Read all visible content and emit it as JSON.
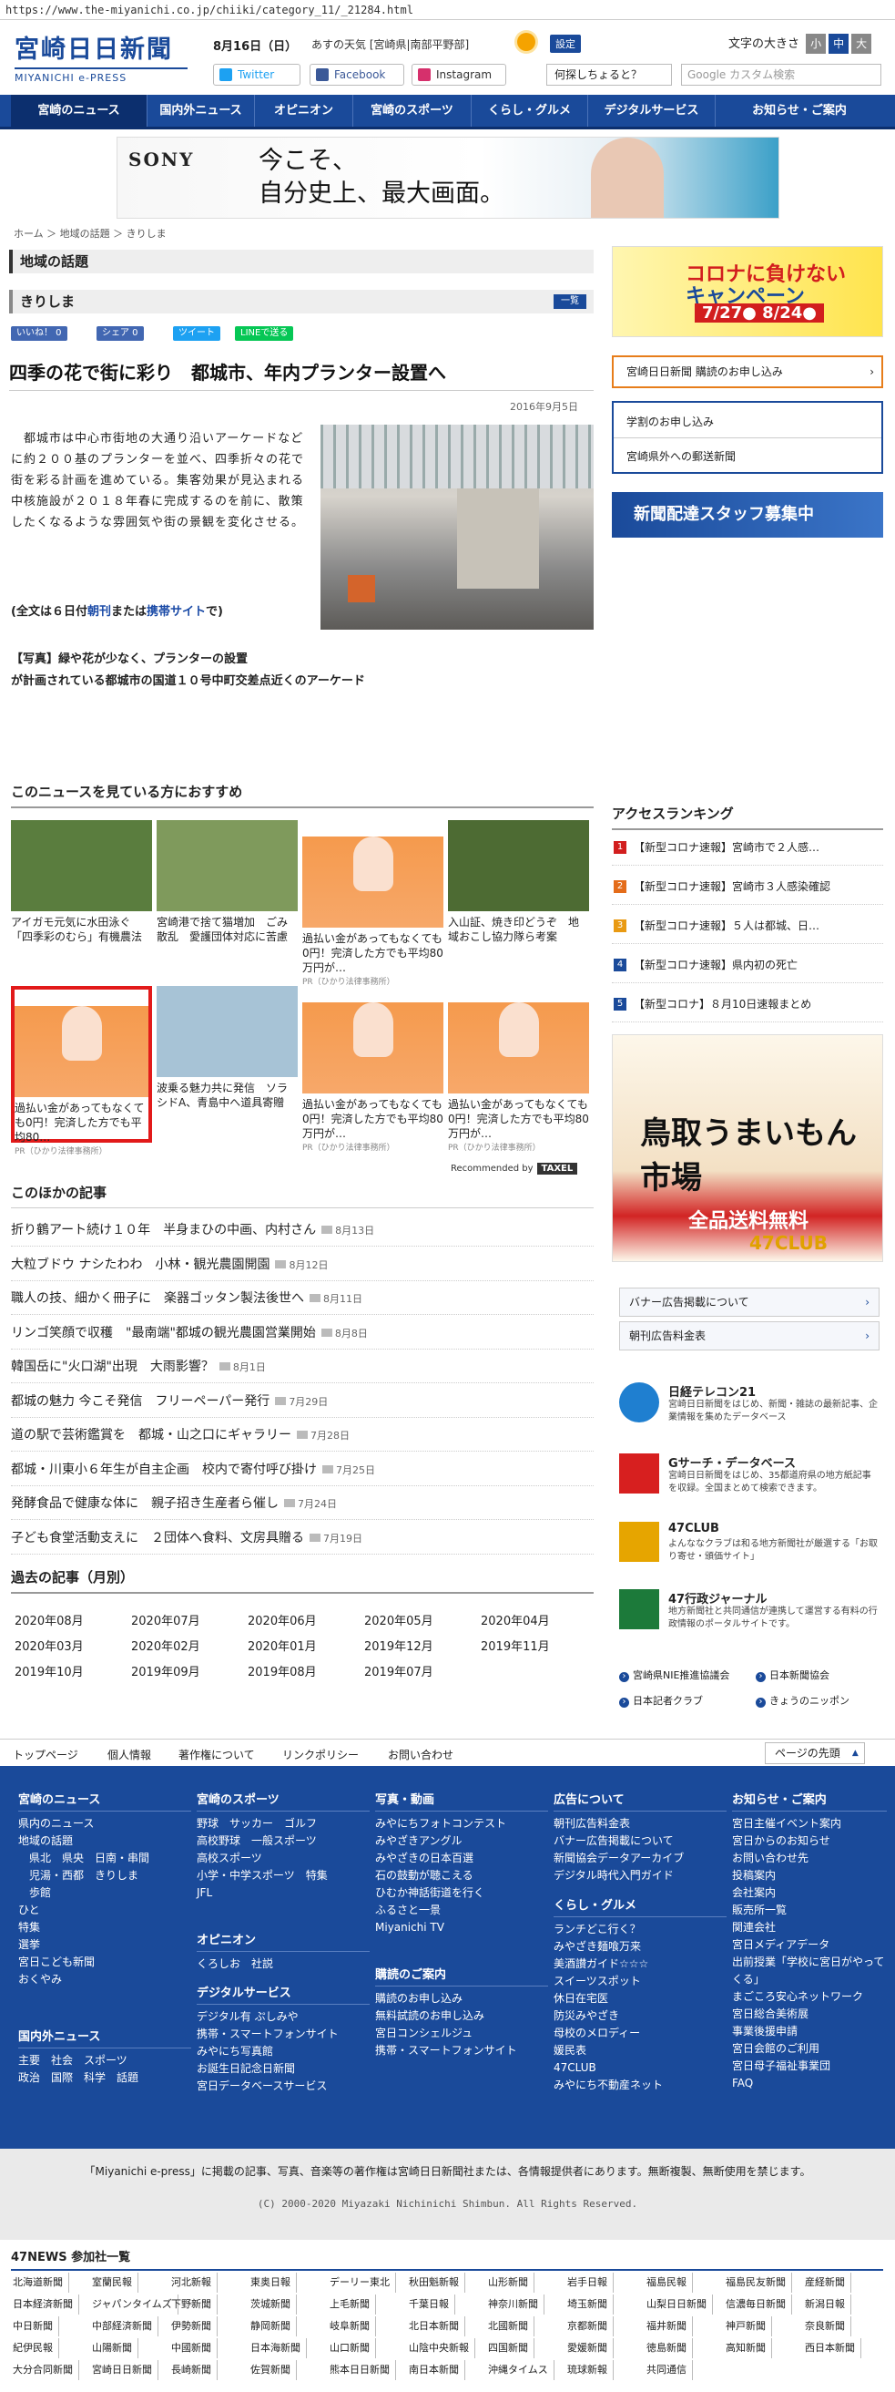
{
  "url": "https://www.the-miyanichi.co.jp/chiiki/category_11/_21284.html",
  "header": {
    "logo_top": "宮崎日日新聞",
    "logo_bottom": "MIYANICHI e-PRESS",
    "date": "8月16日（日）",
    "weather": "あすの天気 [宮崎県|南部平野部]",
    "settings": "設定",
    "font_size_label": "文字の大きさ",
    "font_small": "小",
    "font_medium": "中",
    "font_large": "大",
    "twitter": "Twitter",
    "facebook": "Facebook",
    "instagram": "Instagram",
    "ask": "何探しちょると？",
    "search_placeholder": "Google カスタム検索"
  },
  "nav": [
    "宮崎のニュース",
    "国内外ニュース",
    "オピニオン",
    "宮崎のスポーツ",
    "くらし・グルメ",
    "デジタルサービス",
    "お知らせ・ご案内"
  ],
  "ad": {
    "brand": "SONY",
    "copy1": "今こそ、",
    "copy2": "自分史上、最大画面。"
  },
  "breadcrumb": "ホーム ＞ 地域の話題 ＞ きりしま",
  "section": {
    "title": "地域の話題",
    "sub": "きりしま",
    "list_btn": "一覧"
  },
  "share": {
    "like": "いいね！ 0",
    "fb": "シェア 0",
    "tw": "ツイート",
    "line": "LINEで送る"
  },
  "article": {
    "title": "四季の花で街に彩り　都城市、年内プランター設置へ",
    "date": "2016年9月5日",
    "body": "　都城市は中心市街地の大通り沿いアーケードなどに約２００基のプランターを並べ、四季折々の花で街を彩る計画を進めている。集客効果が見込まれる中核施設が２０１８年春に完成するのを前に、散策したくなるような雰囲気や街の景観を変化させる。",
    "full_pre": "(全文は６日付",
    "full_a": "朝刊",
    "full_mid": "または",
    "full_b": "携帯サイト",
    "full_post": "で)",
    "caption1": "【写真】緑や花が少なく、プランターの設置",
    "caption2": "が計画されている都城市の国道１０号中町交差点近くのアーケード"
  },
  "recommend": {
    "title": "このニュースを見ている方におすすめ",
    "items": [
      {
        "text": "アイガモ元気に水田泳ぐ「四季彩のむら」有機農法",
        "pr": ""
      },
      {
        "text": "宮崎港で捨て猫増加　ごみ散乱　愛護団体対応に苦慮",
        "pr": ""
      },
      {
        "text": "過払い金があってもなくても0円！完済した方でも平均80万円が…",
        "pr": "PR（ひかり法律事務所）"
      },
      {
        "text": "入山証、焼き印どうぞ　地域おこし協力隊ら考案",
        "pr": ""
      },
      {
        "text": "過払い金があってもなくても0円！完済した方でも平均80…",
        "pr": "PR（ひかり法律事務所）"
      },
      {
        "text": "波乗る魅力共に発信　ソラシドA、青島中へ道具寄贈",
        "pr": ""
      },
      {
        "text": "過払い金があってもなくても0円！完済した方でも平均80万円が…",
        "pr": "PR（ひかり法律事務所）"
      },
      {
        "text": "過払い金があってもなくても0円！完済した方でも平均80万円が…",
        "pr": "PR（ひかり法律事務所）"
      }
    ],
    "by": "Recommended by",
    "by_logo": "TAXEL"
  },
  "other": {
    "title": "このほかの記事",
    "items": [
      {
        "t": "折り鶴アート続け１０年　半身まひの中画、内村さん",
        "d": "8月13日"
      },
      {
        "t": "大粒ブドウ ナシたわわ　小林・観光農園開園",
        "d": "8月12日"
      },
      {
        "t": "職人の技、細かく冊子に　楽器ゴッタン製法後世へ",
        "d": "8月11日"
      },
      {
        "t": "リンゴ笑顔で収穫　\"最南端\"都城の観光農園営業開始",
        "d": "8月8日"
      },
      {
        "t": "韓国岳に\"火口湖\"出現　大雨影響？",
        "d": "8月1日"
      },
      {
        "t": "都城の魅力 今こそ発信　フリーペーパー発行",
        "d": "7月29日"
      },
      {
        "t": "道の駅で芸術鑑賞を　都城・山之口にギャラリー",
        "d": "7月28日"
      },
      {
        "t": "都城・川東小６年生が自主企画　校内で寄付呼び掛け",
        "d": "7月25日"
      },
      {
        "t": "発酵食品で健康な体に　親子招き生産者ら催し",
        "d": "7月24日"
      },
      {
        "t": "子ども食堂活動支えに　２団体へ食料、文房具贈る",
        "d": "7月19日"
      }
    ]
  },
  "past": {
    "title": "過去の記事（月別）",
    "months": [
      "2020年08月",
      "2020年07月",
      "2020年06月",
      "2020年05月",
      "2020年04月",
      "2020年03月",
      "2020年02月",
      "2020年01月",
      "2019年12月",
      "2019年11月",
      "2019年10月",
      "2019年09月",
      "2019年08月",
      "2019年07月"
    ]
  },
  "side": {
    "corona_title": "コロナに負けない",
    "corona_camp": "キャンペーン",
    "corona_dates": "7/27● 8/24●",
    "subscribe": "宮崎日日新聞 購読のお申し込み",
    "gakuwari": "学割のお申し込み",
    "kengai": "宮崎県外への郵送新聞",
    "staff": "新聞配達スタッフ募集中",
    "ranking_title": "アクセスランキング",
    "ranking": [
      "【新型コロナ速報】宮崎市で２人感…",
      "【新型コロナ速報】宮崎市３人感染確認",
      "【新型コロナ速報】５人は都城、日…",
      "【新型コロナ速報】県内初の死亡",
      "【新型コロナ】８月10日速報まとめ"
    ],
    "rank_colors": [
      "#d21e1e",
      "#e46c1a",
      "#e99a12",
      "#1a4a9a",
      "#1a4a9a"
    ],
    "tottori_title": "鳥取うまいもん市場",
    "tottori_red": "全品送料無料",
    "tottori_club": "47CLUB",
    "banner1": "バナー広告掲載について",
    "banner2": "朝刊広告料金表",
    "services": [
      {
        "n": "日経テレコン21",
        "d": "宮崎日日新聞をはじめ、新聞・雑誌の最新記事、企業情報を集めたデータベース"
      },
      {
        "n": "Gサーチ・データベース",
        "d": "宮崎日日新聞をはじめ、35都道府県の地方紙記事を収録。全国まとめて検索できます。"
      },
      {
        "n": "47CLUB",
        "d": "よんななクラブは和る地方新聞社が厳選する「お取り寄せ・頒価サイト」"
      },
      {
        "n": "47行政ジャーナル",
        "d": "地方新聞社と共同通信が連携して運営する有料の行政情報のポータルサイトです。"
      }
    ],
    "links": [
      "宮崎県NIE推進協議会",
      "日本新聞協会",
      "日本記者クラブ",
      "きょうのニッポン"
    ]
  },
  "footer": {
    "links": [
      "トップページ",
      "個人情報",
      "著作権について",
      "リンクポリシー",
      "お問い合わせ"
    ],
    "top": "ページの先頭",
    "cols": [
      {
        "h": "宮崎のニュース",
        "i": [
          "県内のニュース",
          "地域の話題",
          "　県北　県央　日南・串間",
          "　児湯・西都　きりしま",
          "　歩館",
          "ひと",
          "特集",
          "選挙",
          "宮日こども新聞",
          "おくやみ"
        ]
      },
      {
        "h": "宮崎のスポーツ",
        "i": [
          "野球　サッカー　ゴルフ",
          "高校野球　一般スポーツ",
          "高校スポーツ",
          "小学・中学スポーツ　特集",
          "JFL"
        ]
      },
      {
        "h": "写真・動画",
        "i": [
          "みやにちフォトコンテスト",
          "みやざきアングル",
          "みやざきの日本百選",
          "石の鼓動が聴こえる",
          "ひむか神話街道を行く",
          "ふるさと一景",
          "Miyanichi TV"
        ]
      },
      {
        "h": "広告について",
        "i": [
          "朝刊広告料金表",
          "バナー広告掲載について",
          "新聞協会データアーカイブ",
          "デジタル時代入門ガイド"
        ]
      },
      {
        "h": "お知らせ・ご案内",
        "i": [
          "宮日主催イベント案内",
          "宮日からのお知らせ",
          "お問い合わせ先",
          "投稿案内",
          "会社案内",
          "販売所一覧",
          "関連会社",
          "宮日メディアデータ",
          "出前授業「学校に宮日がやってくる」",
          "まごころ安心ネットワーク",
          "宮日総合美術展",
          "事業後援申請",
          "宮日会館のご利用",
          "宮日母子福祉事業団",
          "FAQ"
        ]
      }
    ],
    "opinion_h": "オピニオン",
    "opinion_i": "くろしお　社説",
    "digital_h": "デジタルサービス",
    "digital_i": [
      "デジタル有 ぷしみや",
      "携帯・スマートフォンサイト",
      "みやにち写真館",
      "お誕生日記念日新聞",
      "宮日データベースサービス"
    ],
    "kodoku_h": "購読のご案内",
    "kodoku_i": [
      "購読のお申し込み",
      "無料試読のお申し込み",
      "宮日コンシェルジュ",
      "携帯・スマートフォンサイト"
    ],
    "kurashi_h": "くらし・グルメ",
    "kurashi_i": [
      "ランチどこ行く？",
      "みやざき麺喰万来",
      "美酒讃ガイド☆☆☆",
      "スイーツスポット",
      "休日在宅医",
      "防災みやざき",
      "母校のメロディー",
      "媛民表",
      "47CLUB",
      "みやにち不動産ネット"
    ],
    "kokunai_h": "国内外ニュース",
    "kokunai_i": [
      "主要　社会　スポーツ",
      "政治　国際　科学　話題"
    ],
    "note": "「Miyanichi e-press」に掲載の記事、写真、音楽等の著作権は宮崎日日新聞社または、各情報提供者にあります。無断複製、無断使用を禁じます。",
    "copyright": "(C) 2000-2020 Miyazaki Nichinichi Shimbun. All Rights Reserved.",
    "n47": "47NEWS 参加社一覧",
    "papers": [
      "北海道新聞",
      "室蘭民報",
      "河北新報",
      "東奥日報",
      "デーリー東北",
      "秋田魁新報",
      "山形新聞",
      "岩手日報",
      "福島民報",
      "福島民友新聞",
      "産経新聞",
      "日本経済新聞",
      "ジャパンタイムズ",
      "下野新聞",
      "茨城新聞",
      "上毛新聞",
      "千葉日報",
      "神奈川新聞",
      "埼玉新聞",
      "山梨日日新聞",
      "信濃毎日新聞",
      "新潟日報",
      "中日新聞",
      "中部経済新聞",
      "伊勢新聞",
      "静岡新聞",
      "岐阜新聞",
      "北日本新聞",
      "北國新聞",
      "京都新聞",
      "福井新聞",
      "神戸新聞",
      "奈良新聞",
      "紀伊民報",
      "山陽新聞",
      "中國新聞",
      "日本海新聞",
      "山口新聞",
      "山陰中央新報",
      "四国新聞",
      "愛媛新聞",
      "徳島新聞",
      "高知新聞",
      "西日本新聞",
      "大分合同新聞",
      "宮崎日日新聞",
      "長崎新聞",
      "佐賀新聞",
      "熊本日日新聞",
      "南日本新聞",
      "沖縄タイムス",
      "琉球新報",
      "共同通信"
    ]
  }
}
